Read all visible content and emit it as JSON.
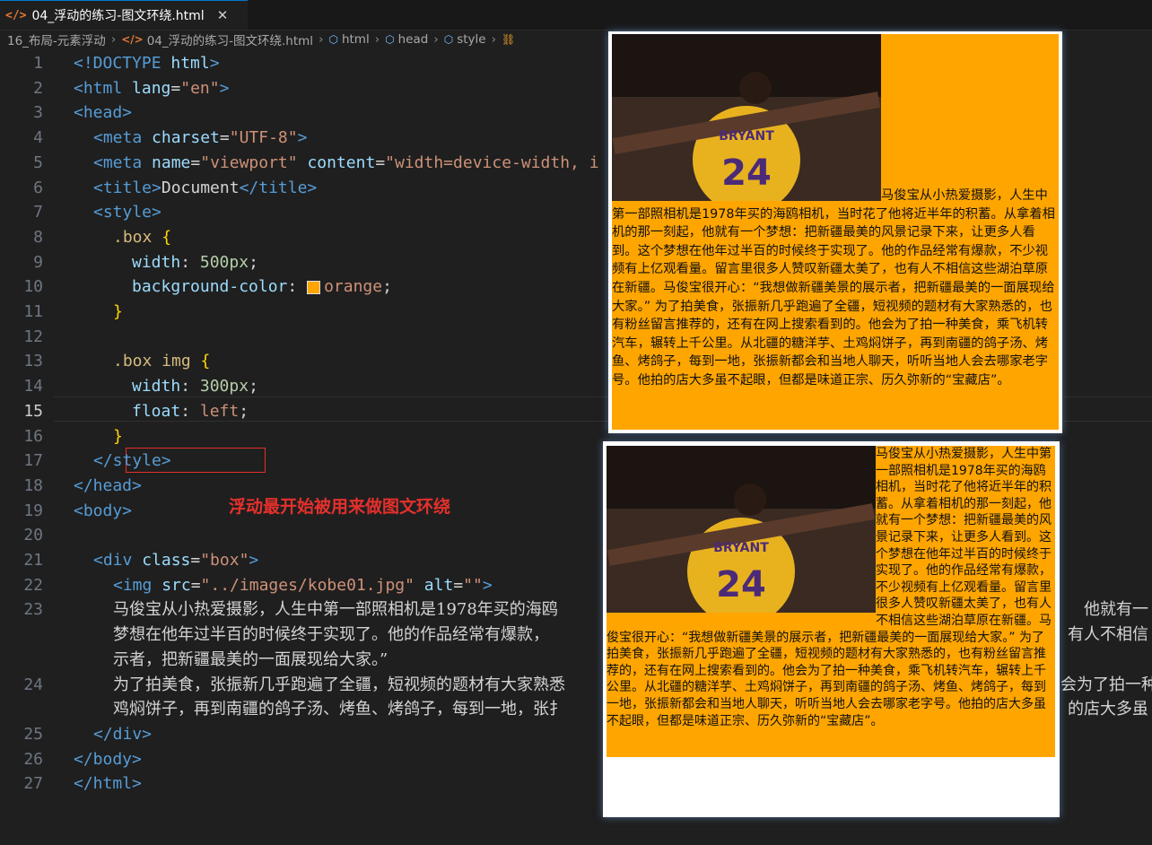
{
  "tab": {
    "icon": "</>",
    "label": "04_浮动的练习-图文环绕.html",
    "close": "✕"
  },
  "breadcrumb": [
    "16_布局-元素浮动",
    "04_浮动的练习-图文环绕.html",
    "html",
    "head",
    "style"
  ],
  "annotation": "浮动最开始被用来做图文环绕",
  "line_numbers": [
    "1",
    "2",
    "3",
    "4",
    "5",
    "6",
    "7",
    "8",
    "9",
    "10",
    "11",
    "12",
    "13",
    "14",
    "15",
    "16",
    "17",
    "18",
    "19",
    "20",
    "21",
    "22",
    "23",
    "",
    "24",
    "",
    "25",
    "26",
    "27"
  ],
  "code": {
    "l1": {
      "a": "<!DOCTYPE ",
      "b": "html",
      "c": ">"
    },
    "l2": {
      "a": "<html ",
      "b": "lang",
      "c": "=",
      "d": "\"en\"",
      "e": ">"
    },
    "l3": "<head>",
    "l4": {
      "a": "<meta ",
      "b": "charset",
      "c": "=",
      "d": "\"UTF-8\"",
      "e": ">"
    },
    "l5": {
      "a": "<meta ",
      "b": "name",
      "c": "=",
      "d": "\"viewport\"",
      "e": " content",
      "f": "=",
      "g": "\"width=device-width, i"
    },
    "l6": {
      "a": "<title>",
      "b": "Document",
      "c": "</title>"
    },
    "l7": "<style>",
    "l8": {
      "a": ".box ",
      "b": "{"
    },
    "l9": {
      "a": "width",
      "b": ": ",
      "c": "500px",
      "d": ";"
    },
    "l10": {
      "a": "background-color",
      "b": ": ",
      "c": "orange",
      "d": ";"
    },
    "l11": "}",
    "l13": {
      "a": ".box img ",
      "b": "{"
    },
    "l14": {
      "a": "width",
      "b": ": ",
      "c": "300px",
      "d": ";"
    },
    "l15": {
      "a": "float",
      "b": ": ",
      "c": "left",
      "d": ";"
    },
    "l16": "}",
    "l17": "</style>",
    "l18": "</head>",
    "l19": "<body>",
    "l21": {
      "a": "<div ",
      "b": "class",
      "c": "=",
      "d": "\"box\"",
      "e": ">"
    },
    "l22": {
      "a": "<img ",
      "b": "src",
      "c": "=",
      "d": "\"../images/kobe01.jpg\"",
      "e": " alt",
      "f": "=",
      "g": "\"\"",
      "h": ">"
    },
    "l23a": "马俊宝从小热爱摄影，人生中第一部照相机是1978年买的海鸥",
    "l23a2": "他就有一",
    "l23b": "梦想在他年过半百的时候终于实现了。他的作品经常有爆款，",
    "l23b2": "有人不相信",
    "l23c": "示者，把新疆最美的一面展现给大家。”",
    "l24a": "为了拍美食，张振新几乎跑遍了全疆，短视频的题材有大家熟悉",
    "l24a2": "会为了拍一种",
    "l24b": "鸡焖饼子，再到南疆的鸽子汤、烤鱼、烤鸽子，每到一地，张扌",
    "l24b2": "的店大多虽",
    "l25": "</div>",
    "l26": "</body>",
    "l27": "</html>"
  },
  "preview_text": "马俊宝从小热爱摄影，人生中第一部照相机是1978年买的海鸥相机，当时花了他将近半年的积蓄。从拿着相机的那一刻起，他就有一个梦想：把新疆最美的风景记录下来，让更多人看到。这个梦想在他年过半百的时候终于实现了。他的作品经常有爆款，不少视频有上亿观看量。留言里很多人赞叹新疆太美了，也有人不相信这些湖泊草原在新疆。马俊宝很开心：“我想做新疆美景的展示者，把新疆最美的一面展现给大家。” 为了拍美食，张振新几乎跑遍了全疆，短视频的题材有大家熟悉的，也有粉丝留言推荐的，还有在网上搜索看到的。他会为了拍一种美食，乘飞机转汽车，辗转上千公里。从北疆的糖洋芋、土鸡焖饼子，再到南疆的鸽子汤、烤鱼、烤鸽子，每到一地，张振新都会和当地人聊天，听听当地人会去哪家老字号。他拍的店大多虽不起眼，但都是味道正宗、历久弥新的“宝藏店”。",
  "colors": {
    "box": "#ffa500",
    "editor_bg": "#1f1f1f",
    "annotation": "#e5302c"
  }
}
